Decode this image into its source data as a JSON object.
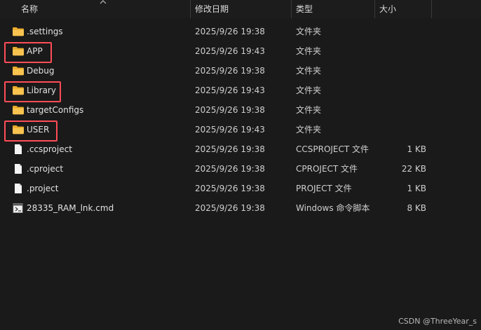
{
  "header": {
    "name": "名称",
    "date": "修改日期",
    "type": "类型",
    "size": "大小"
  },
  "files": [
    {
      "name": ".settings",
      "date": "2025/9/26 19:38",
      "type": "文件夹",
      "size": "",
      "icon": "folder-icon",
      "highlighted": false
    },
    {
      "name": "APP",
      "date": "2025/9/26 19:43",
      "type": "文件夹",
      "size": "",
      "icon": "folder-icon",
      "highlighted": true
    },
    {
      "name": "Debug",
      "date": "2025/9/26 19:38",
      "type": "文件夹",
      "size": "",
      "icon": "folder-icon",
      "highlighted": false
    },
    {
      "name": "Library",
      "date": "2025/9/26 19:43",
      "type": "文件夹",
      "size": "",
      "icon": "folder-icon",
      "highlighted": true
    },
    {
      "name": "targetConfigs",
      "date": "2025/9/26 19:38",
      "type": "文件夹",
      "size": "",
      "icon": "folder-icon",
      "highlighted": false
    },
    {
      "name": "USER",
      "date": "2025/9/26 19:43",
      "type": "文件夹",
      "size": "",
      "icon": "folder-icon",
      "highlighted": true
    },
    {
      "name": ".ccsproject",
      "date": "2025/9/26 19:38",
      "type": "CCSPROJECT 文件",
      "size": "1 KB",
      "icon": "file-icon",
      "highlighted": false
    },
    {
      "name": ".cproject",
      "date": "2025/9/26 19:38",
      "type": "CPROJECT 文件",
      "size": "22 KB",
      "icon": "file-icon",
      "highlighted": false
    },
    {
      "name": ".project",
      "date": "2025/9/26 19:38",
      "type": "PROJECT 文件",
      "size": "1 KB",
      "icon": "file-icon",
      "highlighted": false
    },
    {
      "name": "28335_RAM_lnk.cmd",
      "date": "2025/9/26 19:38",
      "type": "Windows 命令脚本",
      "size": "8 KB",
      "icon": "cmd-script-icon",
      "highlighted": false
    }
  ],
  "watermark": "CSDN @ThreeYear_s",
  "colors": {
    "background": "#1a1a1a",
    "folder": "#f8c44f",
    "highlight": "#ff4d57"
  }
}
